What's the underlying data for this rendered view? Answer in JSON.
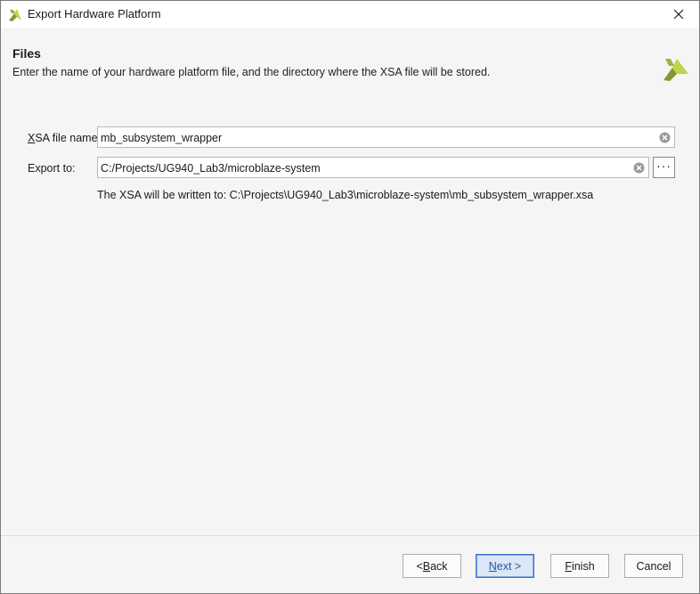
{
  "window": {
    "title": "Export Hardware Platform",
    "icon": "xilinx-logo-icon",
    "close_icon": "close-icon"
  },
  "header": {
    "title": "Files",
    "description": "Enter the name of your hardware platform file, and the directory where the XSA file will be stored.",
    "logo": "xilinx-logo-icon"
  },
  "form": {
    "xsa_name": {
      "label_mnemonic": "X",
      "label_rest": "SA file name:",
      "value": "mb_subsystem_wrapper"
    },
    "export_to": {
      "label": "Export to:",
      "value": "C:/Projects/UG940_Lab3/microblaze-system",
      "browse_label": "···"
    },
    "note": "The XSA will be written to: C:\\Projects\\UG940_Lab3\\microblaze-system\\mb_subsystem_wrapper.xsa"
  },
  "buttons": {
    "back": {
      "prefix": "< ",
      "mnemonic": "B",
      "rest": "ack"
    },
    "next": {
      "mnemonic": "N",
      "rest": "ext >"
    },
    "finish": {
      "mnemonic": "F",
      "rest": "inish"
    },
    "cancel": "Cancel"
  },
  "colors": {
    "accent": "#3a74c9",
    "logo_green": "#8aa83a",
    "logo_yellow": "#c8d84a"
  }
}
